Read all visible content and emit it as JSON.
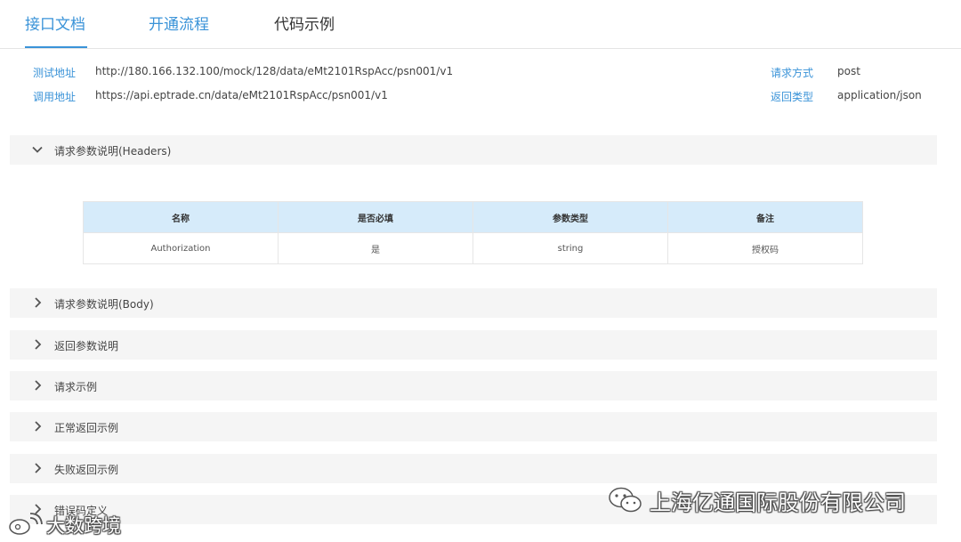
{
  "tabs": [
    {
      "label": "接口文档",
      "active": true
    },
    {
      "label": "开通流程",
      "active": false
    },
    {
      "label": "代码示例",
      "active": false
    }
  ],
  "info": {
    "test_url_label": "测试地址",
    "test_url": "http://180.166.132.100/mock/128/data/eMt2101RspAcc/psn001/v1",
    "call_url_label": "调用地址",
    "call_url": "https://api.eptrade.cn/data/eMt2101RspAcc/psn001/v1",
    "method_label": "请求方式",
    "method": "post",
    "return_type_label": "返回类型",
    "return_type": "application/json"
  },
  "sections": [
    {
      "title": "请求参数说明(Headers)",
      "expanded": true,
      "icon": "chevron-down-icon"
    },
    {
      "title": "请求参数说明(Body)",
      "expanded": false,
      "icon": "chevron-right-icon"
    },
    {
      "title": "返回参数说明",
      "expanded": false,
      "icon": "chevron-right-icon"
    },
    {
      "title": "请求示例",
      "expanded": false,
      "icon": "chevron-right-icon"
    },
    {
      "title": "正常返回示例",
      "expanded": false,
      "icon": "chevron-right-icon"
    },
    {
      "title": "失败返回示例",
      "expanded": false,
      "icon": "chevron-right-icon"
    },
    {
      "title": "错误码定义",
      "expanded": false,
      "icon": "chevron-right-icon"
    }
  ],
  "headers_table": {
    "columns": [
      "名称",
      "是否必填",
      "参数类型",
      "备注"
    ],
    "rows": [
      [
        "Authorization",
        "是",
        "string",
        "授权码"
      ]
    ]
  },
  "watermarks": {
    "right_text": "上海亿通国际股份有限公司",
    "left_text": "大数跨境"
  },
  "colors": {
    "accent": "#3a93d8",
    "section_bg": "#f5f5f5",
    "table_header_bg": "#d6ebfa"
  }
}
